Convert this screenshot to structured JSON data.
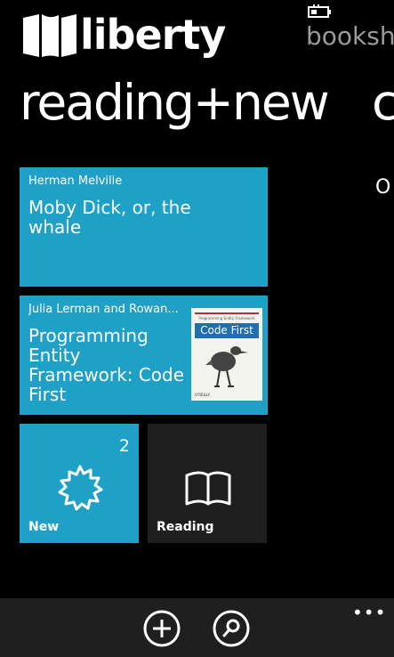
{
  "header": {
    "app_title": "liberty",
    "next_section_title": "bookshe",
    "logo_icon": "book-logo-icon",
    "status_icon": "battery-charging-icon"
  },
  "panorama": {
    "title": "reading+new",
    "next_title_peek": "c",
    "next_content_peek": "O"
  },
  "tiles": {
    "book1": {
      "author": "Herman Melville",
      "title": "Moby Dick, or, the whale"
    },
    "book2": {
      "author": "Julia Lerman and Rowan...",
      "title": "Programming Entity Framework: Code First",
      "cover": {
        "small_text": "Programming Entity Framework",
        "title": "Code First",
        "publisher": "O'REILLY"
      }
    },
    "new": {
      "label": "New",
      "count": "2",
      "icon": "sun-badge-icon"
    },
    "reading": {
      "label": "Reading",
      "icon": "open-book-icon"
    }
  },
  "appbar": {
    "buttons": [
      {
        "icon": "add-icon"
      },
      {
        "icon": "search-icon"
      }
    ],
    "more": "•••"
  },
  "colors": {
    "accent": "#1fa0c6",
    "background": "#000000",
    "tile_dark": "#1f1f1f"
  }
}
